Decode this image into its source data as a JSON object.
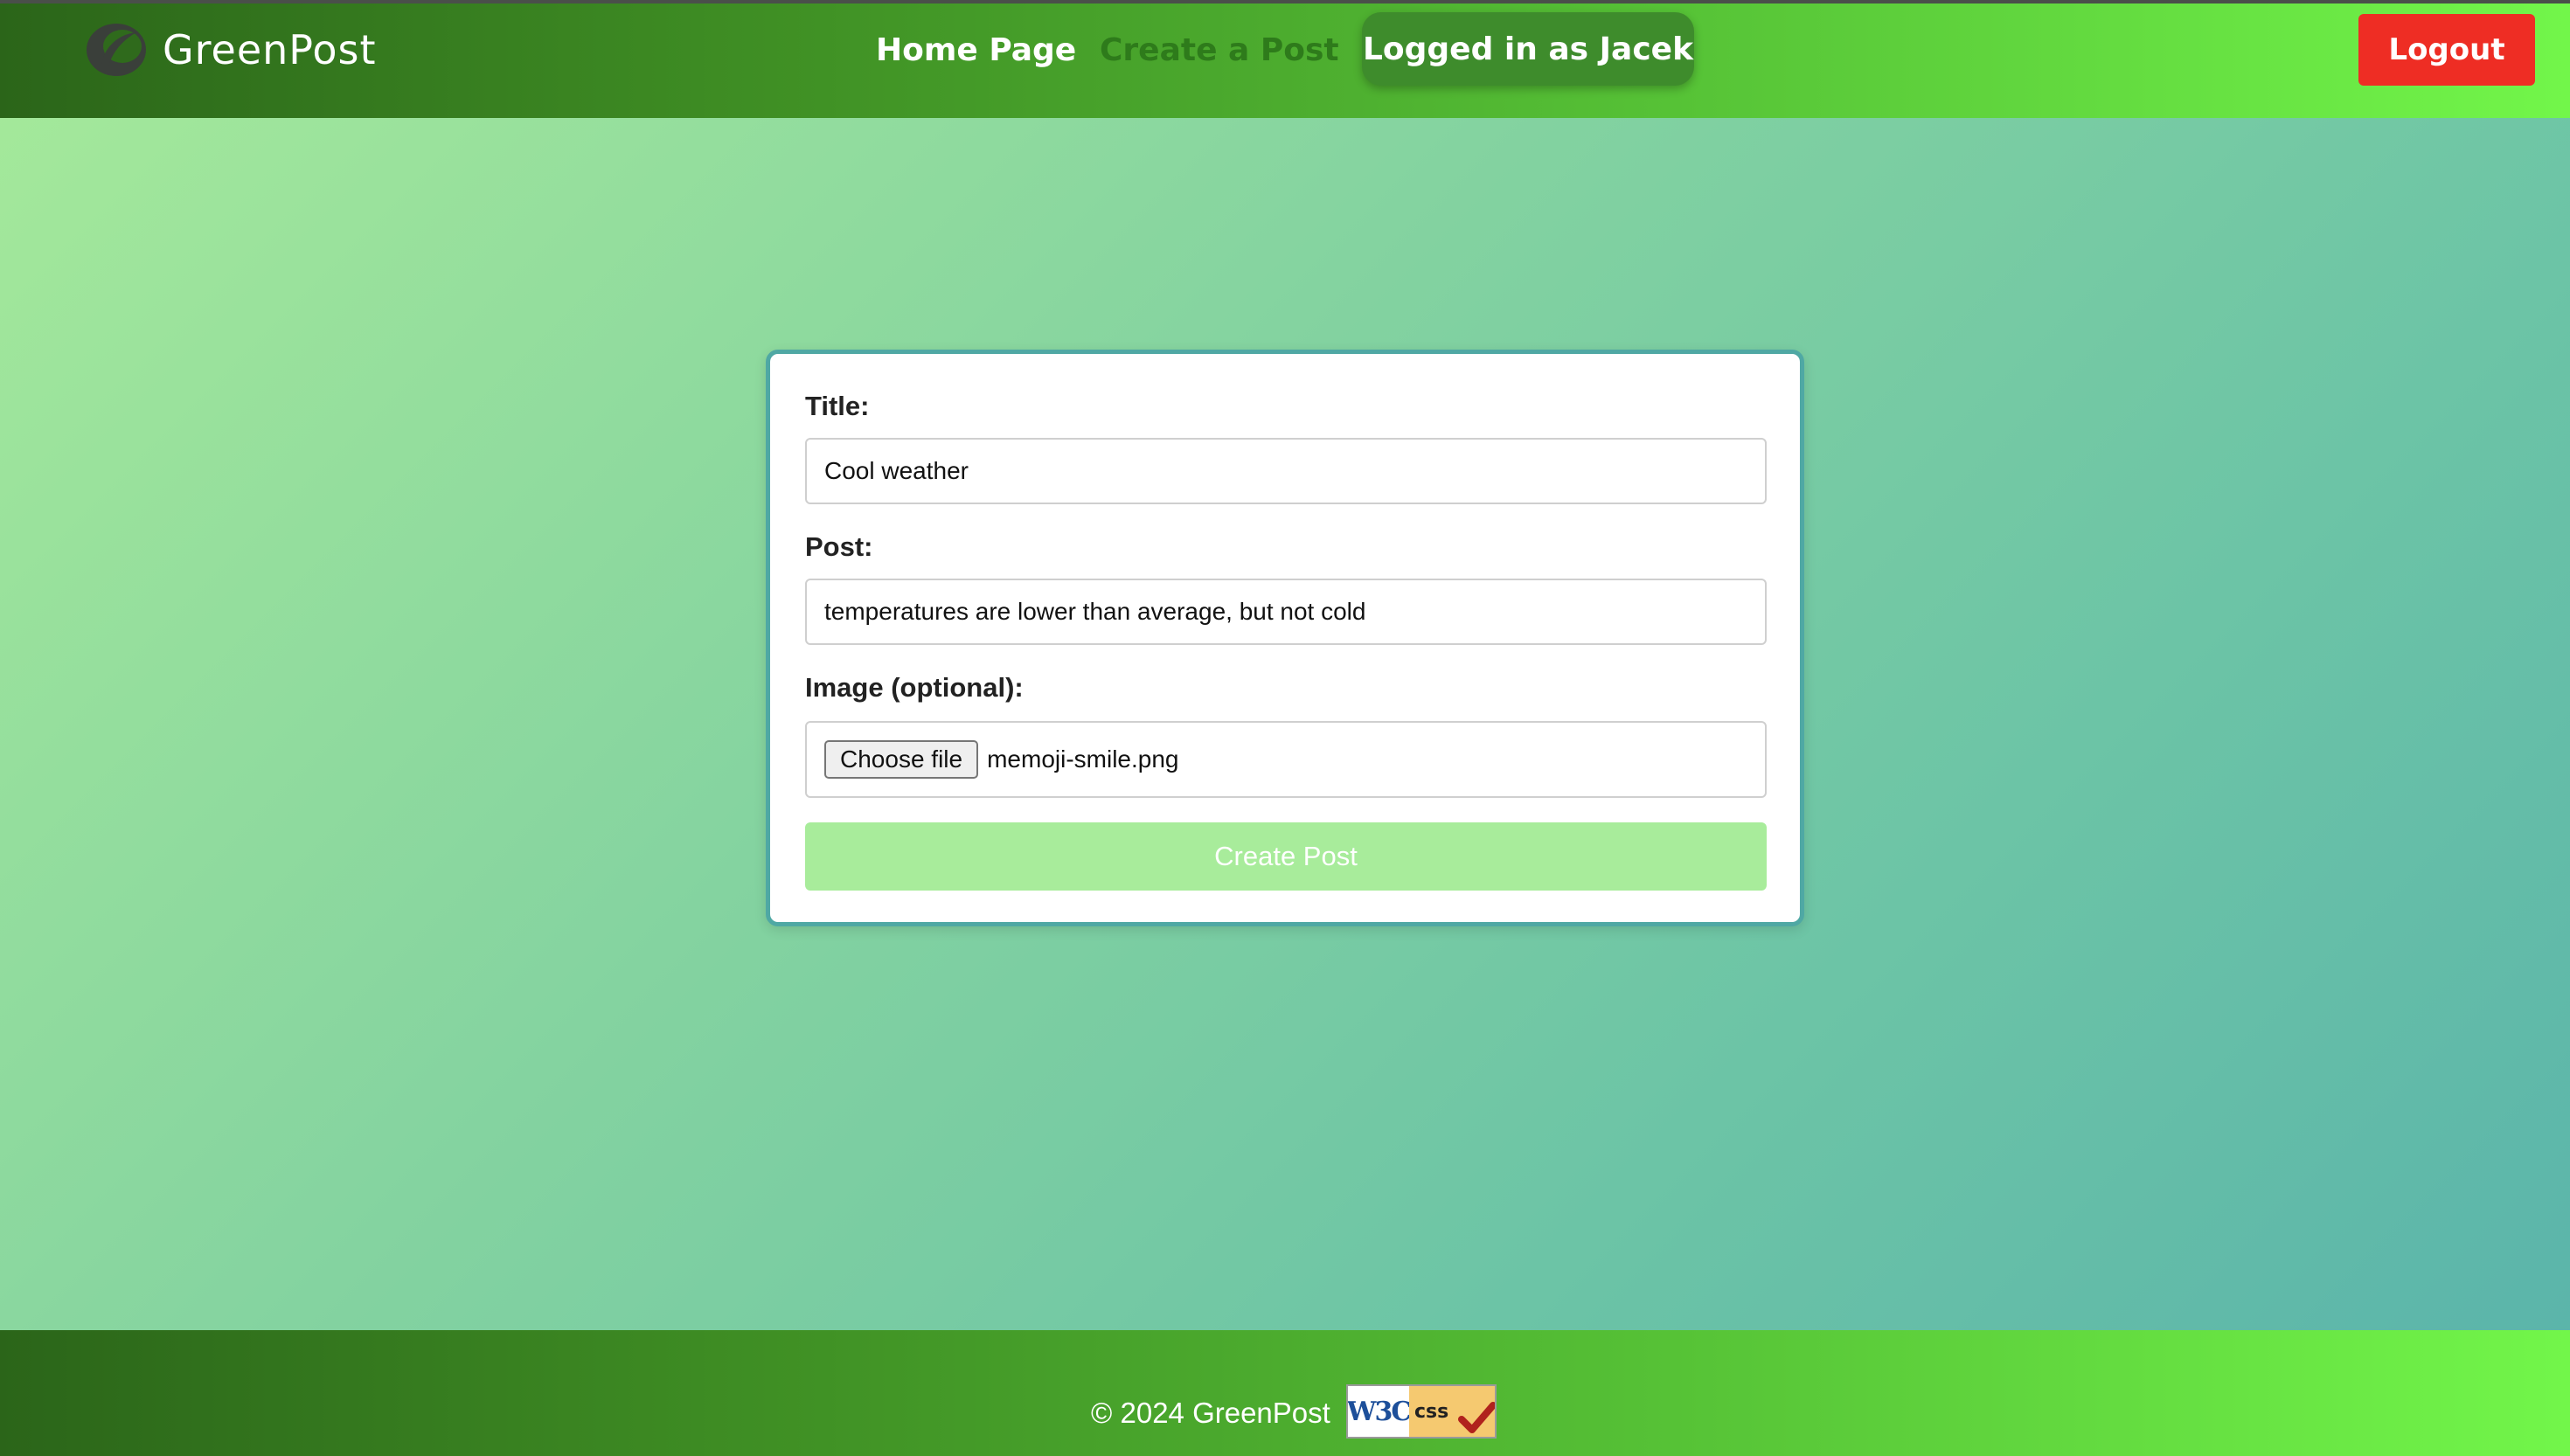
{
  "header": {
    "brand": "GreenPost",
    "nav": {
      "home": "Home Page",
      "create": "Create a Post"
    },
    "logged_in_text": "Logged in as Jacek",
    "logout_label": "Logout"
  },
  "form": {
    "title_label": "Title:",
    "title_value": "Cool weather",
    "post_label": "Post:",
    "post_value": "temperatures are lower than average, but not cold",
    "image_label": "Image (optional):",
    "choose_file_label": "Choose file",
    "file_name": "memoji-smile.png",
    "submit_label": "Create Post"
  },
  "footer": {
    "copyright": "© 2024 GreenPost",
    "badge": {
      "left": "W3C",
      "right": "css"
    }
  },
  "colors": {
    "header_start": "#2b6519",
    "header_end": "#72f64a",
    "logout": "#ee2d24",
    "logged_pill": "#3e8c2c",
    "submit_disabled": "#a8ec9b",
    "card_border": "#4fa8a4"
  },
  "icons": {
    "logo": "greenpost-logo-icon",
    "badge_check": "checkmark-icon"
  }
}
